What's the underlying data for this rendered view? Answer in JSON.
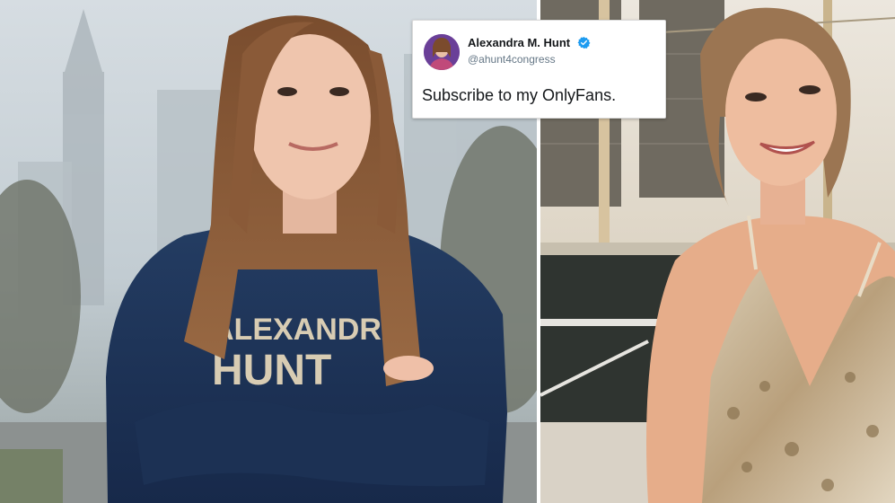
{
  "tweet": {
    "display_name": "Alexandra M. Hunt",
    "handle": "@ahunt4congress",
    "text": "Subscribe to my OnlyFans.",
    "verified_color": "#1d9bf0"
  },
  "photos": {
    "left_sweatshirt_text": [
      "ALEXANDRA",
      "HUNT"
    ]
  },
  "colors": {
    "sweatshirt": "#1f3456",
    "hair": "#8a5a38",
    "dress": "#c9b79c",
    "sky_left": "#cfd8df",
    "sky_right": "#e7e2d8"
  }
}
